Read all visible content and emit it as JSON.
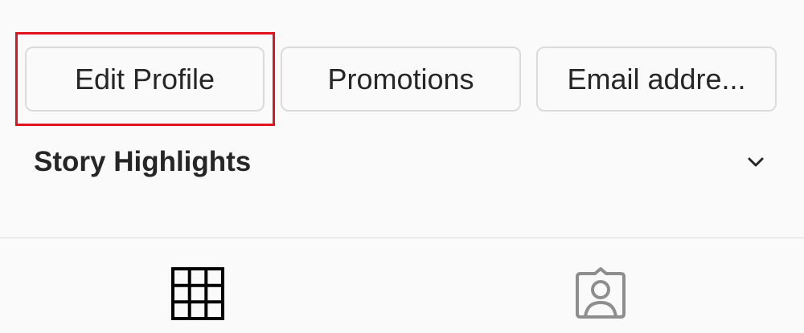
{
  "profile_actions": {
    "edit_profile_label": "Edit Profile",
    "promotions_label": "Promotions",
    "email_label": "Email addre..."
  },
  "story_highlights": {
    "title": "Story Highlights",
    "toggle_icon": "chevron-down-icon"
  },
  "tabs": [
    {
      "name": "posts-grid",
      "icon": "grid-icon",
      "active": true
    },
    {
      "name": "tagged",
      "icon": "tagged-user-icon",
      "active": false
    }
  ],
  "colors": {
    "background": "#fafafa",
    "button_border": "#dbdbdb",
    "text": "#262626",
    "highlight_outline": "#e0141e",
    "inactive_icon": "#8e8e8e"
  }
}
